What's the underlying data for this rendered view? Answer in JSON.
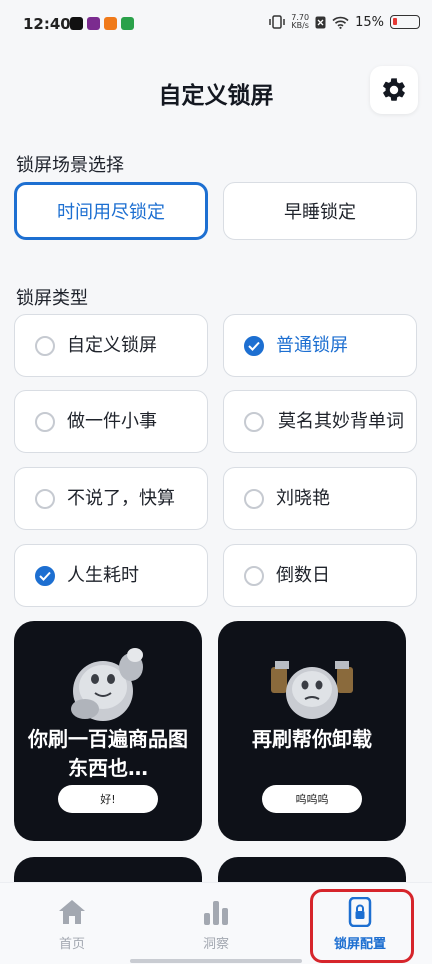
{
  "status_bar": {
    "time": "12:40",
    "net_speed_value": "7.70",
    "net_speed_unit": "KB/s",
    "battery": "15%"
  },
  "header": {
    "title": "自定义锁屏"
  },
  "scene": {
    "label": "锁屏场景选择",
    "options": [
      "时间用尽锁定",
      "早睡锁定"
    ],
    "selected": "时间用尽锁定"
  },
  "lock_type": {
    "label": "锁屏类型",
    "options": [
      {
        "label": "自定义锁屏",
        "checked": false
      },
      {
        "label": "普通锁屏",
        "checked": true
      },
      {
        "label": "做一件小事",
        "checked": false
      },
      {
        "label": "莫名其妙背单词",
        "checked": false
      },
      {
        "label": "不说了，快算",
        "checked": false
      },
      {
        "label": "刘晓艳",
        "checked": false
      },
      {
        "label": "人生耗时",
        "checked": true
      },
      {
        "label": "倒数日",
        "checked": false
      }
    ]
  },
  "cards": [
    {
      "text": "你刷一百遍商品图东西也…",
      "button": "好!"
    },
    {
      "text": "再刷帮你卸载",
      "button": "呜呜呜"
    }
  ],
  "bottom_nav": {
    "items": [
      {
        "label": "首页",
        "icon": "home-icon",
        "active": false
      },
      {
        "label": "洞察",
        "icon": "bar-chart-icon",
        "active": false
      },
      {
        "label": "锁屏配置",
        "icon": "lock-phone-icon",
        "active": true
      }
    ]
  },
  "colors": {
    "accent": "#1d6fd1",
    "card_bg": "#0e1118",
    "highlight": "#d6252b"
  }
}
